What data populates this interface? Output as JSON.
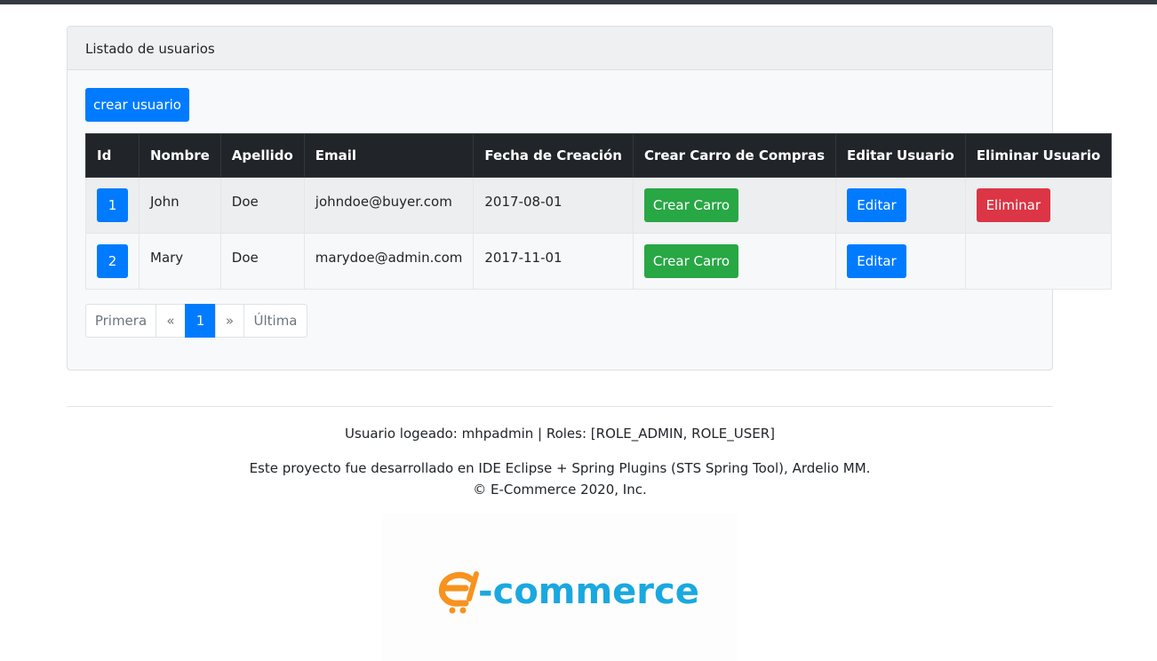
{
  "card": {
    "title": "Listado de usuarios",
    "create_button": "crear usuario"
  },
  "table": {
    "headers": [
      "Id",
      "Nombre",
      "Apellido",
      "Email",
      "Fecha de Creación",
      "Crear Carro de Compras",
      "Editar Usuario",
      "Eliminar Usuario"
    ],
    "rows": [
      {
        "id": "1",
        "nombre": "John",
        "apellido": "Doe",
        "email": "johndoe@buyer.com",
        "fecha": "2017-08-01",
        "cart_label": "Crear Carro",
        "edit_label": "Editar",
        "delete_label": "Eliminar"
      },
      {
        "id": "2",
        "nombre": "Mary",
        "apellido": "Doe",
        "email": "marydoe@admin.com",
        "fecha": "2017-11-01",
        "cart_label": "Crear Carro",
        "edit_label": "Editar"
      }
    ]
  },
  "pagination": {
    "first": "Primera",
    "prev": "«",
    "current": "1",
    "next": "»",
    "last": "Última"
  },
  "footer": {
    "user_info": "Usuario logeado: mhpadmin | Roles: [ROLE_ADMIN, ROLE_USER]",
    "credits": "Este proyecto fue desarrollado en IDE Eclipse + Spring Plugins (STS Spring Tool), Ardelio MM.",
    "copyright": "© E-Commerce 2020, Inc."
  },
  "logo": {
    "text": "-commerce",
    "icon": "shopping-cart-e-icon"
  },
  "colors": {
    "primary": "#007bff",
    "success": "#28a745",
    "danger": "#dc3545",
    "table_header": "#212529",
    "logo_orange": "#f7931e",
    "logo_blue": "#1aa8e0"
  }
}
